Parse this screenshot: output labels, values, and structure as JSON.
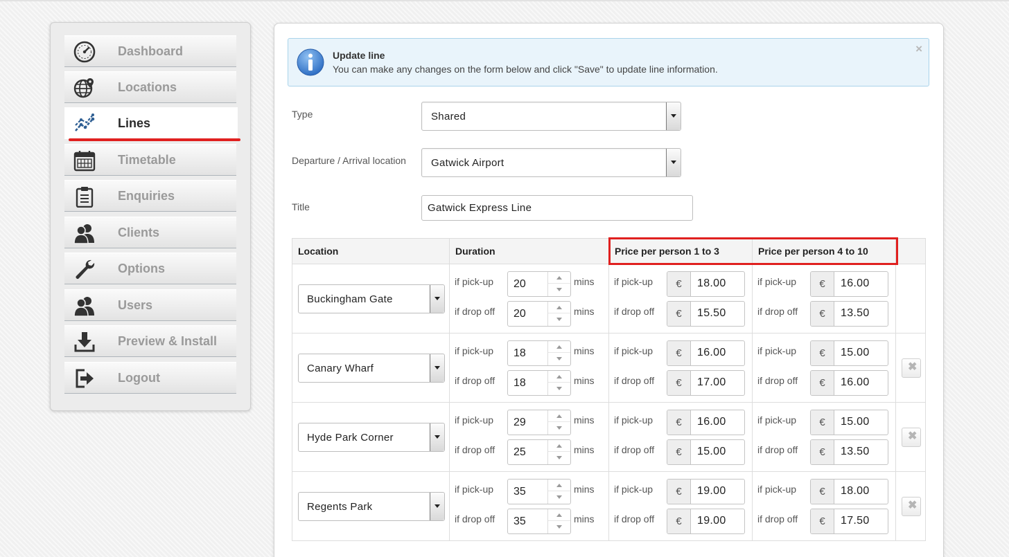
{
  "sidebar": {
    "items": [
      {
        "label": "Dashboard",
        "icon": "speedometer-icon"
      },
      {
        "label": "Locations",
        "icon": "globe-pin-icon"
      },
      {
        "label": "Lines",
        "icon": "line-chart-icon"
      },
      {
        "label": "Timetable",
        "icon": "calendar-icon"
      },
      {
        "label": "Enquiries",
        "icon": "clipboard-icon"
      },
      {
        "label": "Clients",
        "icon": "users-icon"
      },
      {
        "label": "Options",
        "icon": "wrench-icon"
      },
      {
        "label": "Users",
        "icon": "users-icon"
      },
      {
        "label": "Preview & Install",
        "icon": "download-icon"
      },
      {
        "label": "Logout",
        "icon": "logout-icon"
      }
    ],
    "active": "Lines"
  },
  "alert": {
    "title": "Update line",
    "text": "You can make any changes on the form below and click \"Save\" to update line information.",
    "close": "×"
  },
  "form": {
    "type_label": "Type",
    "type_value": "Shared",
    "location_label": "Departure / Arrival location",
    "location_value": "Gatwick Airport",
    "title_label": "Title",
    "title_value": "Gatwick Express Line"
  },
  "table": {
    "headers": {
      "location": "Location",
      "duration": "Duration",
      "price_1_3": "Price per person 1 to 3",
      "price_4_10": "Price per person 4 to 10"
    },
    "pickup_label": "if pick-up",
    "dropoff_label": "if drop off",
    "unit": "mins",
    "currency": "€",
    "rows": [
      {
        "location": "Buckingham Gate",
        "pickup_mins": "20",
        "dropoff_mins": "20",
        "p13_pickup": "18.00",
        "p13_dropoff": "15.50",
        "p410_pickup": "16.00",
        "p410_dropoff": "13.50"
      },
      {
        "location": "Canary Wharf",
        "pickup_mins": "18",
        "dropoff_mins": "18",
        "p13_pickup": "16.00",
        "p13_dropoff": "17.00",
        "p410_pickup": "15.00",
        "p410_dropoff": "16.00"
      },
      {
        "location": "Hyde Park Corner",
        "pickup_mins": "29",
        "dropoff_mins": "25",
        "p13_pickup": "16.00",
        "p13_dropoff": "15.00",
        "p410_pickup": "15.00",
        "p410_dropoff": "13.50"
      },
      {
        "location": "Regents Park",
        "pickup_mins": "35",
        "dropoff_mins": "35",
        "p13_pickup": "19.00",
        "p13_dropoff": "19.00",
        "p410_pickup": "18.00",
        "p410_dropoff": "17.50"
      }
    ]
  },
  "colors": {
    "accent_red": "#e0201f",
    "alert_bg": "#e9f4fb",
    "alert_border": "#a9d3ea",
    "info_blue": "#3f7fd2"
  }
}
